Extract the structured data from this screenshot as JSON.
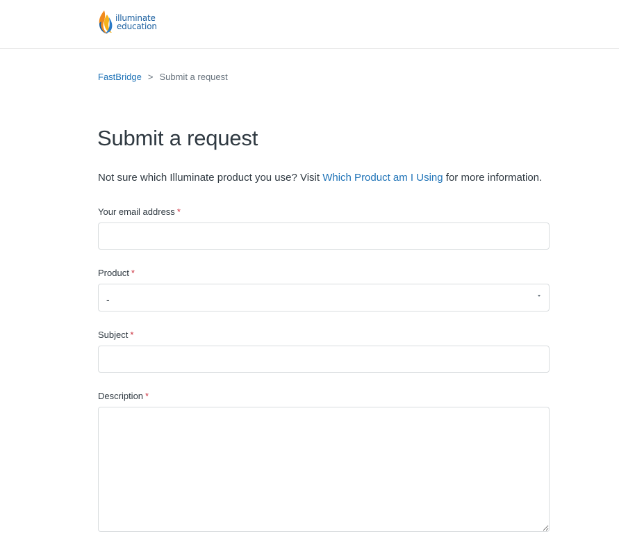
{
  "header": {
    "logo_line1": "illuminate",
    "logo_line2": "education"
  },
  "breadcrumb": {
    "items": [
      "FastBridge",
      "Submit a request"
    ],
    "separator": ">"
  },
  "page": {
    "title": "Submit a request",
    "intro_before": "Not sure which Illuminate product you use? Visit ",
    "intro_link": "Which Product am I Using",
    "intro_after": " for more information."
  },
  "form": {
    "required_marker": "*",
    "email_label": "Your email address",
    "email_value": "",
    "product_label": "Product",
    "product_value": "-",
    "subject_label": "Subject",
    "subject_value": "",
    "description_label": "Description",
    "description_value": ""
  },
  "colors": {
    "link": "#1f73b7",
    "required": "#cc3340",
    "logo_text": "#1a5fa0"
  },
  "icons": [
    "logo-flame-icon",
    "chevron-down-icon"
  ]
}
